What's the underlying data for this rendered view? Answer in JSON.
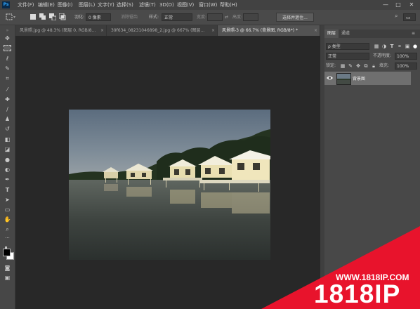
{
  "app": {
    "logo": "Ps"
  },
  "menu": [
    "文件(F)",
    "编辑(E)",
    "图像(I)",
    "图层(L)",
    "文字(Y)",
    "选择(S)",
    "滤镜(T)",
    "3D(D)",
    "视图(V)",
    "窗口(W)",
    "帮助(H)"
  ],
  "window_controls": {
    "minimize": "—",
    "restore": "□",
    "close": "✕"
  },
  "options_bar": {
    "feather_label": "羽化:",
    "feather_value": "0 像素",
    "antialias_label": "消除锯齿",
    "style_label": "样式:",
    "style_value": "正常",
    "width_label": "宽度:",
    "height_label": "高度:",
    "select_mask_button": "选择并遮住..."
  },
  "tabs": [
    {
      "label": "风景照.jpg @ 48.3% (图层 0, RGB/8...",
      "close": "×"
    },
    {
      "label": "39f634_08231046898_2.jpg @ 667% (图层...",
      "close": "×"
    },
    {
      "label": "风景照-3 @ 66.7% (背景图, RGB/8*) *",
      "close": "×"
    }
  ],
  "layers_panel": {
    "tabs": [
      "图层",
      "通道"
    ],
    "kind_filter": "ρ 类型",
    "blend_mode": "正常",
    "opacity_label": "不透明度:",
    "opacity_value": "100%",
    "lock_label": "锁定:",
    "fill_label": "填充:",
    "fill_value": "100%",
    "layers": [
      {
        "name": "背景图",
        "visible_icon": "eye-icon"
      }
    ]
  },
  "watermark": {
    "url": "WWW.1818IP.COM",
    "brand": "1818IP",
    "color": "#e8132c"
  },
  "colors": {
    "menubar": "#424242",
    "canvas_bg": "#282828",
    "panel": "#484848"
  }
}
